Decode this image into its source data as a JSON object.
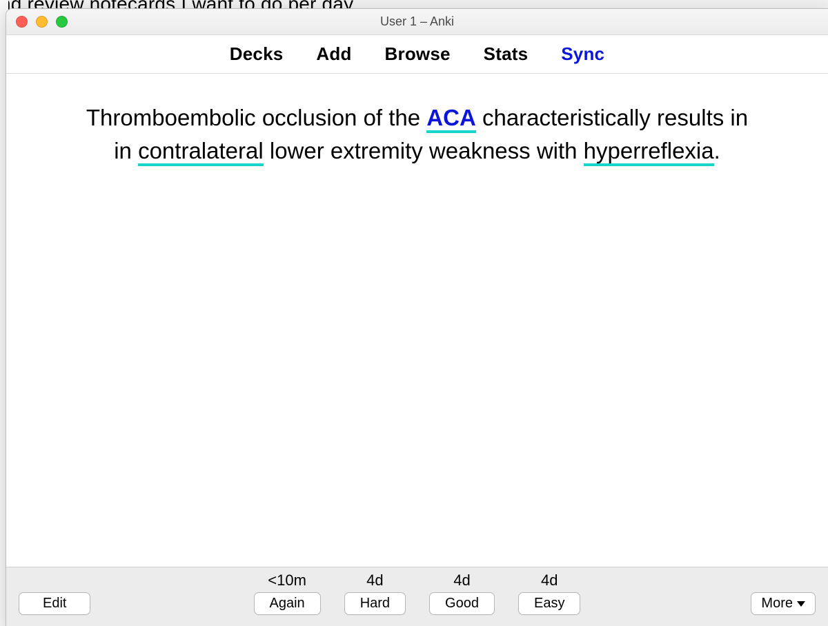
{
  "behind_text": "nd review notecards I want to do per day.",
  "window": {
    "title": "User 1 – Anki"
  },
  "toolbar": {
    "decks": "Decks",
    "add": "Add",
    "browse": "Browse",
    "stats": "Stats",
    "sync": "Sync"
  },
  "card": {
    "pre": "Thromboembolic occlusion of the ",
    "cloze": "ACA",
    "mid1": " characteristically results in ",
    "ul1": "contralateral",
    "mid2": " lower extremity weakness with ",
    "ul2": "hyperreflexia",
    "post": "."
  },
  "answer": {
    "again_time": "<10m",
    "hard_time": "4d",
    "good_time": "4d",
    "easy_time": "4d",
    "again": "Again",
    "hard": "Hard",
    "good": "Good",
    "easy": "Easy"
  },
  "buttons": {
    "edit": "Edit",
    "more": "More"
  }
}
